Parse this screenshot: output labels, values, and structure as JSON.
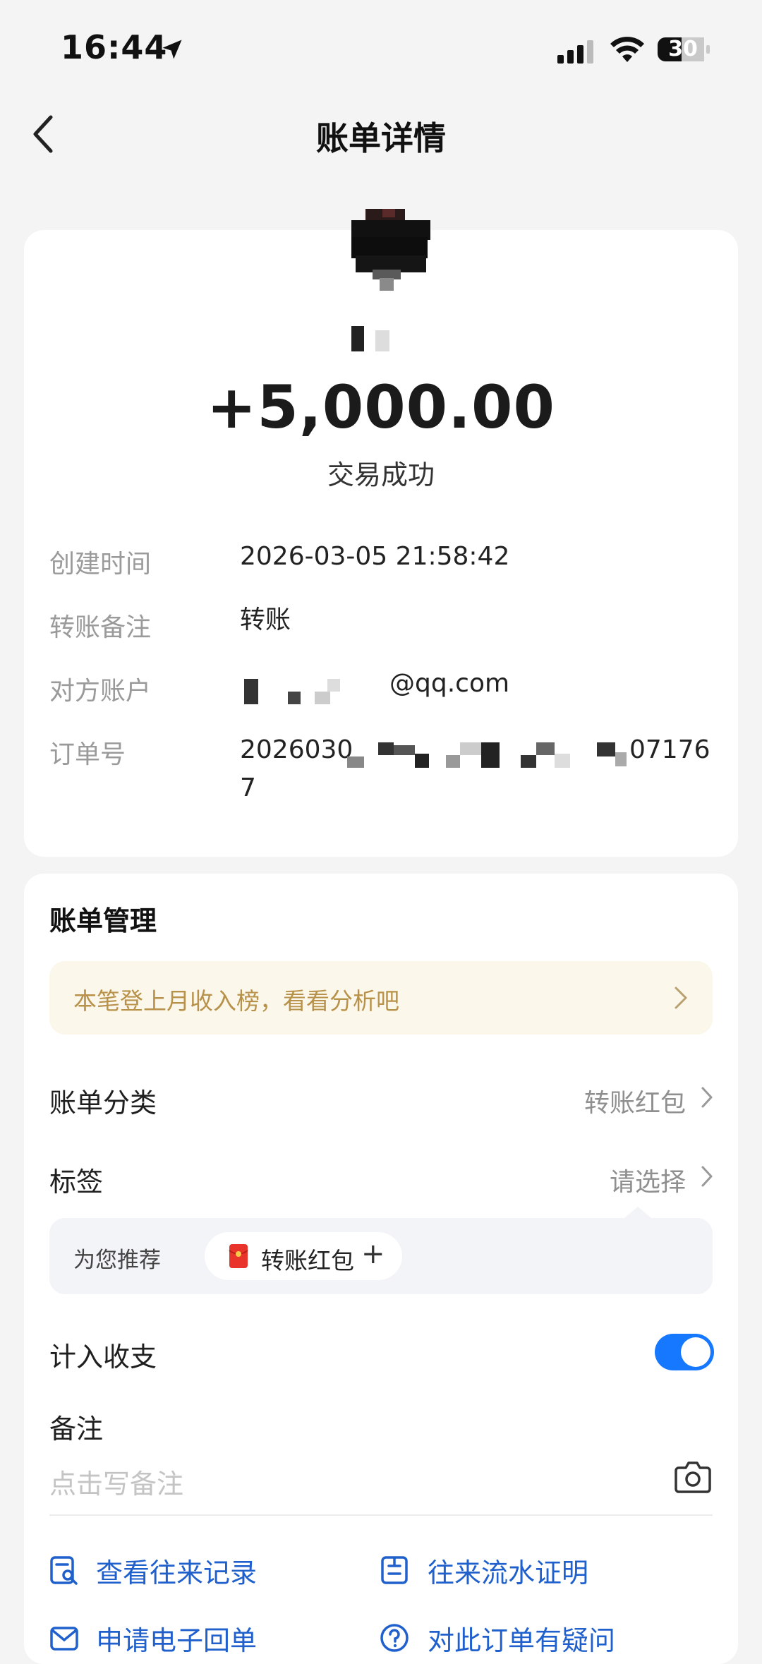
{
  "status_bar": {
    "time": "16:44",
    "battery": "30"
  },
  "nav": {
    "title": "账单详情"
  },
  "transaction": {
    "amount": "+5,000.00",
    "status": "交易成功",
    "fields": [
      {
        "label": "创建时间",
        "value": "2026-03-05 21:58:42"
      },
      {
        "label": "转账备注",
        "value": "转账"
      },
      {
        "label": "对方账户",
        "value": "@qq.com"
      },
      {
        "label": "订单号",
        "value_start": "2026030",
        "value_end": "07176",
        "value_line2": "7"
      }
    ]
  },
  "management": {
    "title": "账单管理",
    "promo": "本笔登上月收入榜，看看分析吧",
    "category": {
      "label": "账单分类",
      "value": "转账红包"
    },
    "tags": {
      "label": "标签",
      "value": "请选择"
    },
    "recommend": {
      "label": "为您推荐",
      "chip": "转账红包",
      "plus": "+"
    },
    "count_in": {
      "label": "计入收支",
      "enabled": true
    },
    "note": {
      "label": "备注",
      "placeholder": "点击写备注"
    }
  },
  "actions": [
    {
      "label": "查看往来记录",
      "icon": "history-search-icon"
    },
    {
      "label": "往来流水证明",
      "icon": "statement-icon"
    },
    {
      "label": "申请电子回单",
      "icon": "mail-icon"
    },
    {
      "label": "对此订单有疑问",
      "icon": "question-icon"
    }
  ],
  "colors": {
    "accent": "#1677ff",
    "promo_text": "#b8924a",
    "link": "#2060cc"
  }
}
